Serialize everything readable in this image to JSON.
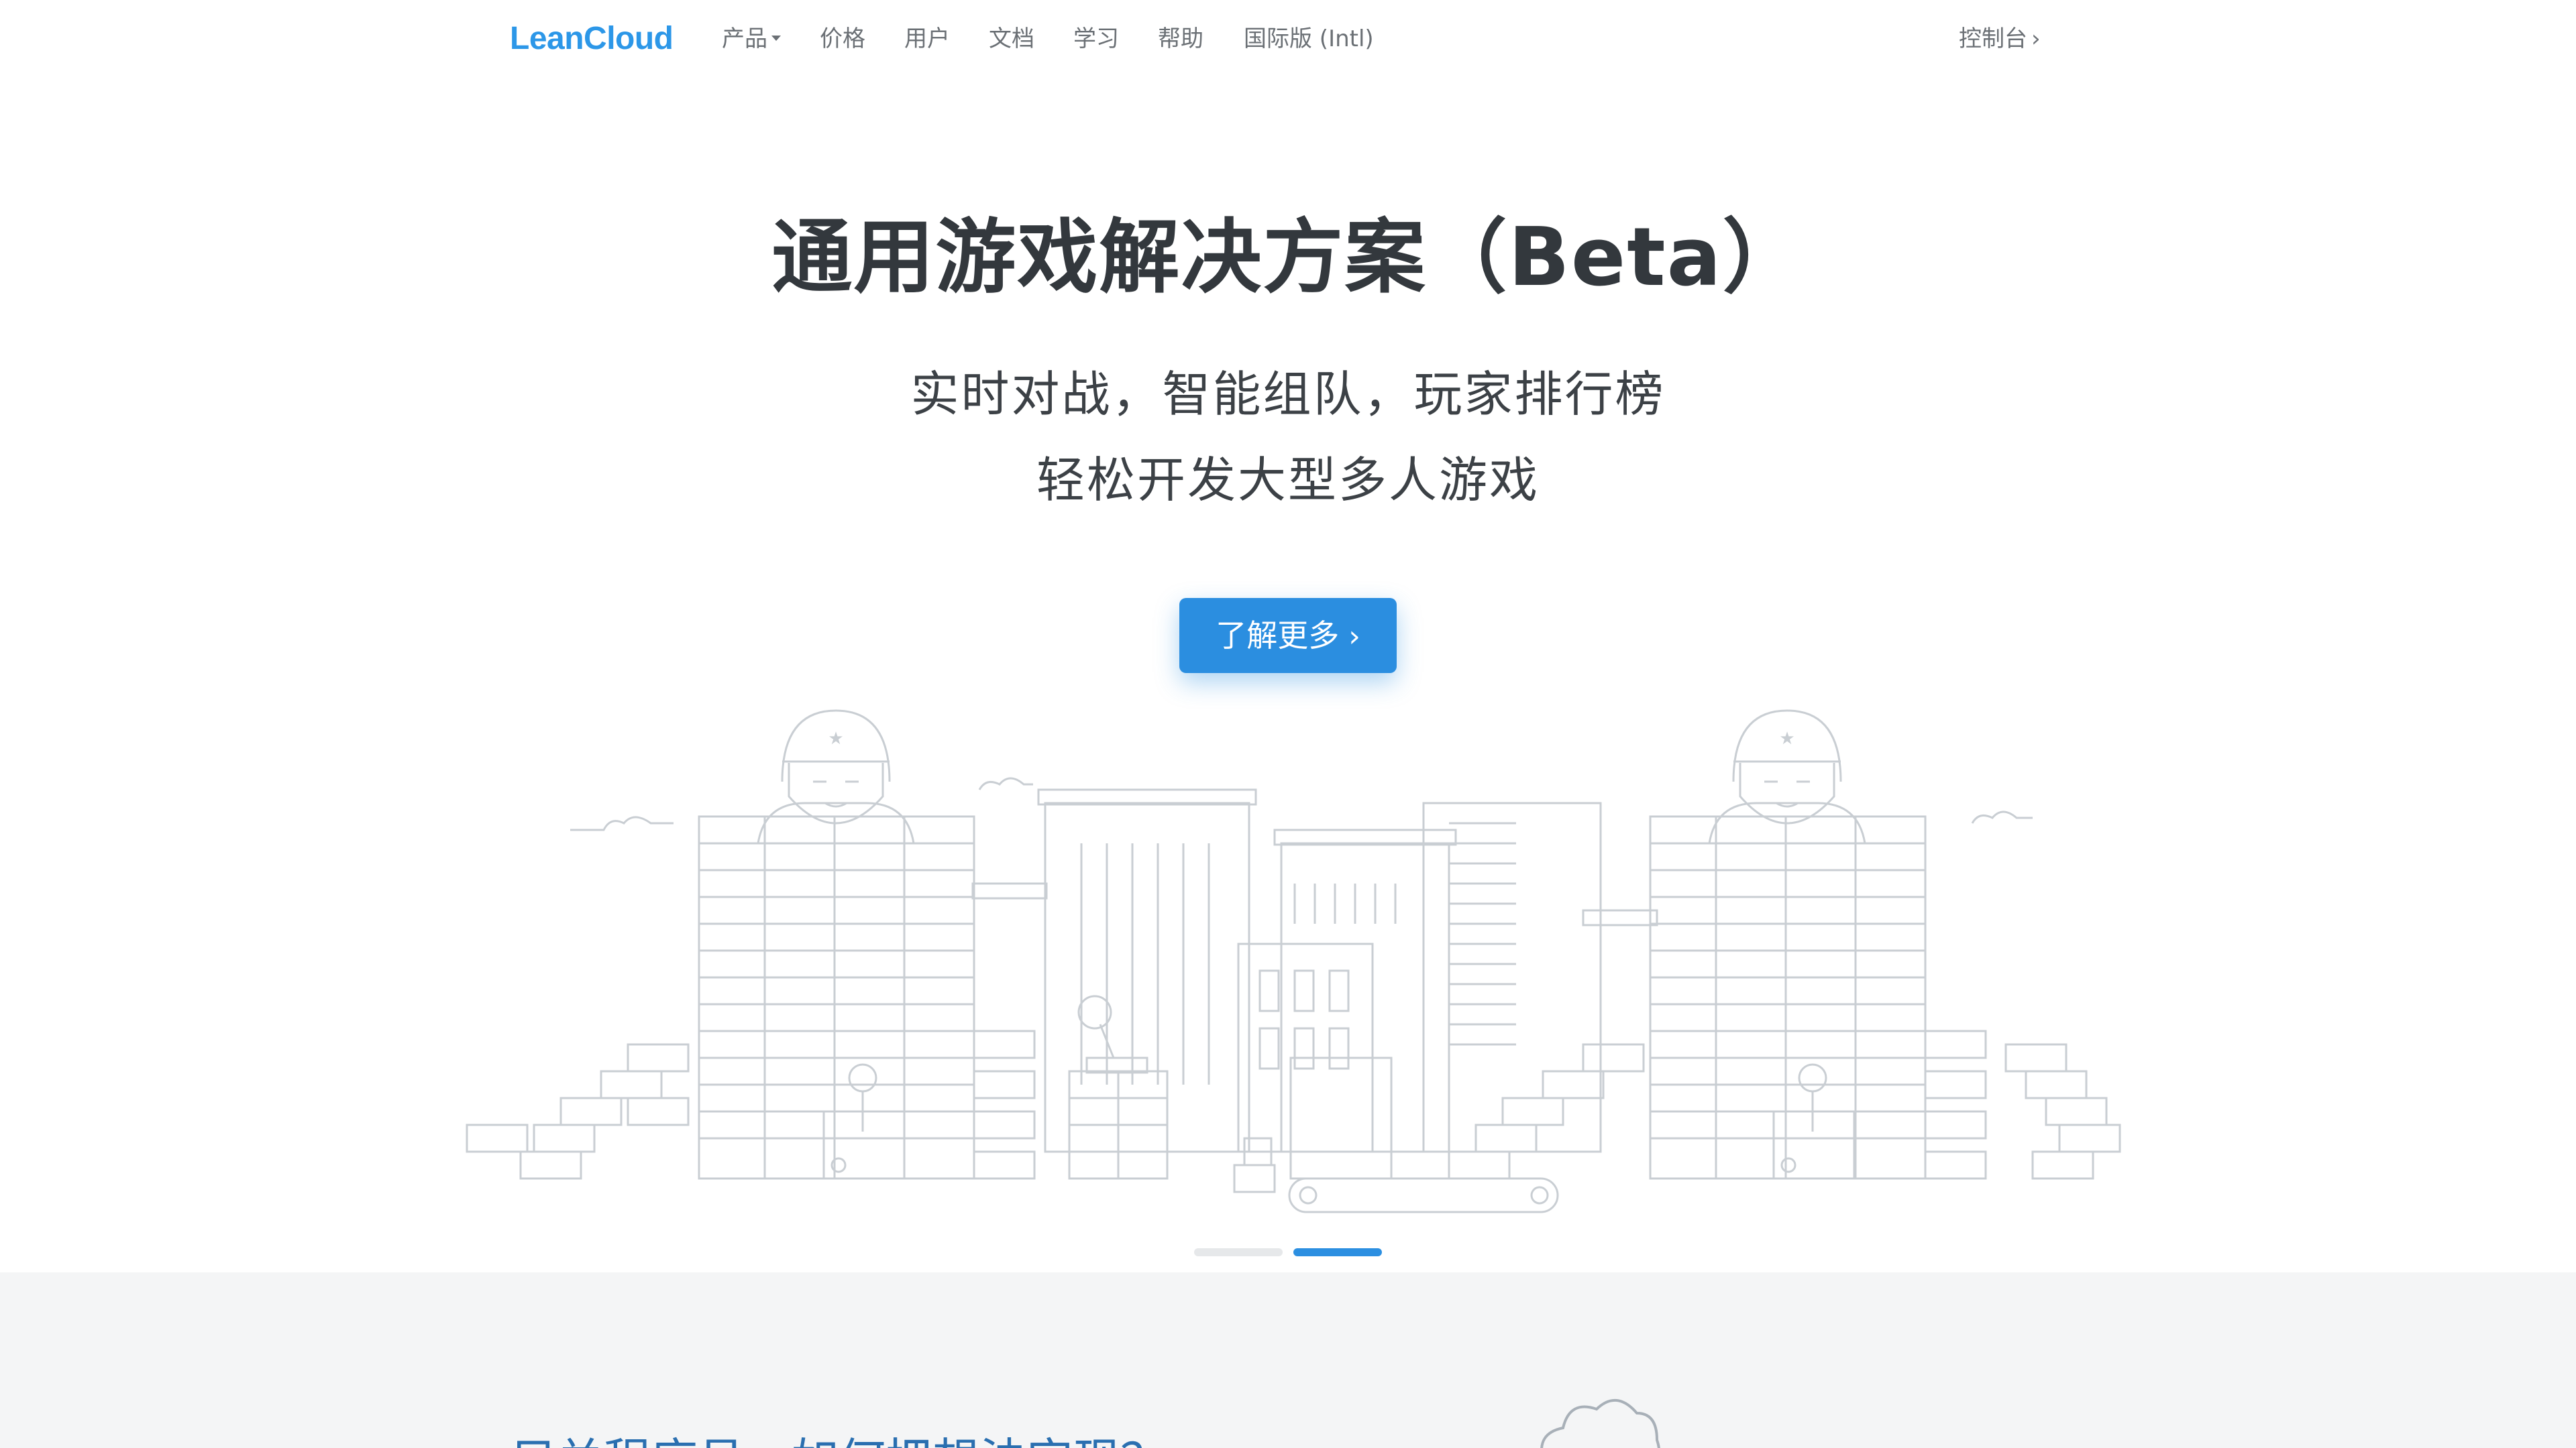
{
  "navbar": {
    "brand": "LeanCloud",
    "items": [
      {
        "label": "产品",
        "has_dropdown": true
      },
      {
        "label": "价格"
      },
      {
        "label": "用户"
      },
      {
        "label": "文档"
      },
      {
        "label": "学习"
      },
      {
        "label": "帮助"
      },
      {
        "label": "国际版 (Intl)"
      }
    ],
    "console_label": "控制台",
    "chevron": "›"
  },
  "hero": {
    "title": "通用游戏解决方案（Beta）",
    "subtitle_line1": "实时对战，智能组队，玩家排行榜",
    "subtitle_line2": "轻松开发大型多人游戏",
    "cta_label": "了解更多",
    "cta_chevron": "›"
  },
  "carousel": {
    "slide_count": 2,
    "active_index": 1
  },
  "lower": {
    "heading": "只关程序员，如何把想法实现？"
  },
  "colors": {
    "brand": "#2c97e8",
    "cta": "#2b8ee0",
    "title": "#33383d",
    "nav_text": "#6b7075",
    "lower_bg": "#f4f5f6",
    "illustration_stroke": "#c9ced3"
  },
  "icons": {
    "dropdown": "caret-down-icon",
    "console": "chevron-right-icon",
    "cta": "chevron-right-icon"
  }
}
